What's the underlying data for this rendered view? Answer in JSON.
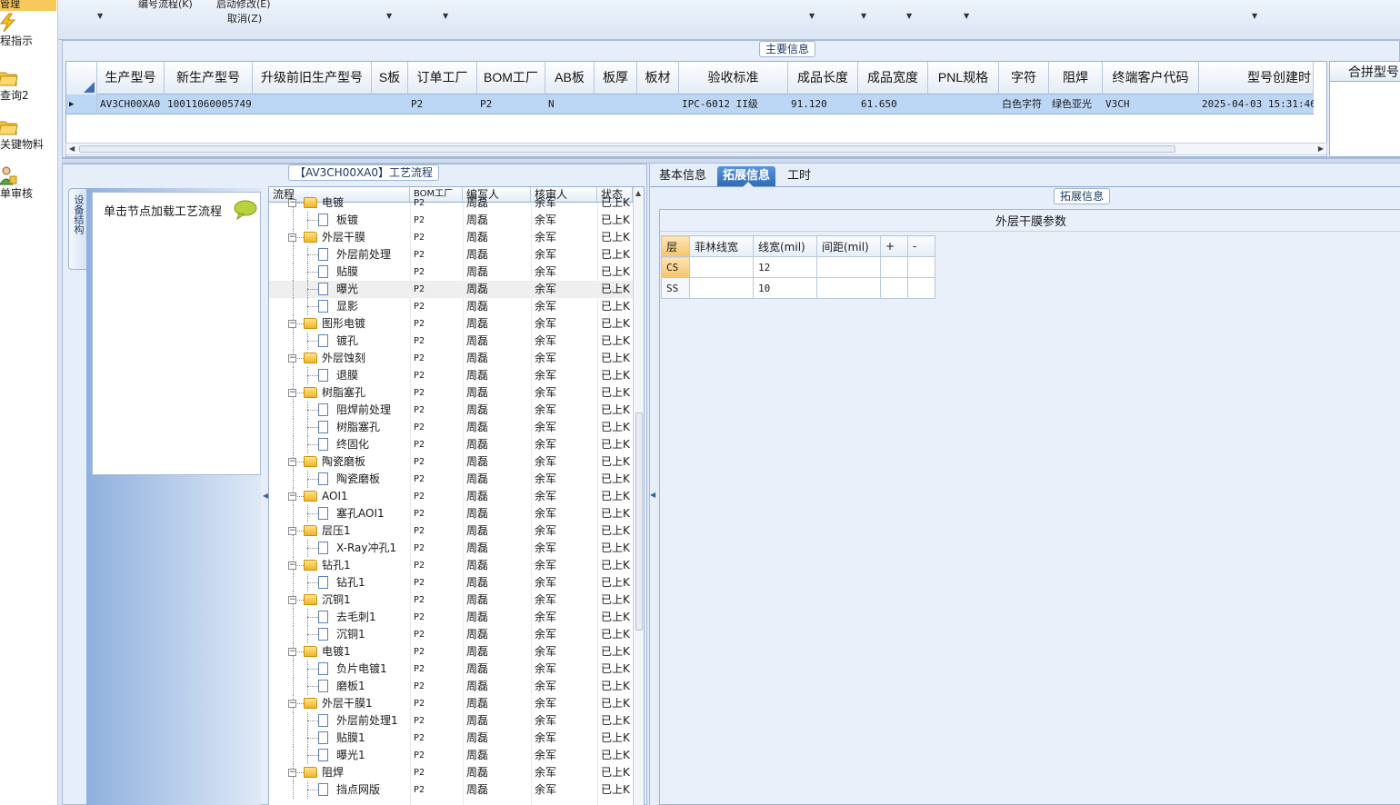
{
  "nav": {
    "top_item": "管理",
    "items": [
      {
        "label": "程指示",
        "icon": "lightning-icon"
      },
      {
        "label": "查询2",
        "icon": "folder-open-icon"
      },
      {
        "label": "关键物料",
        "icon": "folder-open-icon"
      },
      {
        "label": "单审核",
        "icon": "user-icon"
      }
    ]
  },
  "topbar": {
    "label1": "编号流程(K)",
    "label2": "启动修改(E)",
    "label3": "取消(Z)"
  },
  "main_info": {
    "legend": "主要信息",
    "columns": [
      "生产型号",
      "新生产型号",
      "升级前旧生产型号",
      "S板",
      "订单工厂",
      "BOM工厂",
      "AB板",
      "板厚",
      "板材",
      "验收标准",
      "成品长度",
      "成品宽度",
      "PNL规格",
      "字符",
      "阻焊",
      "终端客户代码",
      "型号创建时"
    ],
    "row": [
      "AV3CH00XA0",
      "10011060005749",
      "",
      "",
      "P2",
      "P2",
      "N",
      "",
      "",
      "IPC-6012 II级",
      "91.120",
      "61.650",
      "",
      "白色字符",
      "绿色亚光",
      "V3CH",
      "2025-04-03 15:31:46"
    ],
    "merge_header": "合拼型号"
  },
  "process": {
    "legend": "【AV3CH00XA0】工艺流程",
    "vertical_tab": "设备结构",
    "tip": "单击节点加载工艺流程",
    "columns": [
      "流程",
      "BOM工厂",
      "编写人",
      "核审人",
      "状态"
    ],
    "rows": [
      {
        "name": "电镀",
        "level": 0,
        "bom": "P2",
        "writer": "周磊",
        "checker": "余军",
        "status": "已上K"
      },
      {
        "name": "板镀",
        "level": 1,
        "bom": "P2",
        "writer": "周磊",
        "checker": "余军",
        "status": "已上K"
      },
      {
        "name": "外层干膜",
        "level": 0,
        "bom": "P2",
        "writer": "周磊",
        "checker": "余军",
        "status": "已上K"
      },
      {
        "name": "外层前处理",
        "level": 1,
        "bom": "P2",
        "writer": "周磊",
        "checker": "余军",
        "status": "已上K"
      },
      {
        "name": "贴膜",
        "level": 1,
        "bom": "P2",
        "writer": "周磊",
        "checker": "余军",
        "status": "已上K"
      },
      {
        "name": "曝光",
        "level": 1,
        "bom": "P2",
        "writer": "周磊",
        "checker": "余军",
        "status": "已上K",
        "selected": true
      },
      {
        "name": "显影",
        "level": 1,
        "bom": "P2",
        "writer": "周磊",
        "checker": "余军",
        "status": "已上K"
      },
      {
        "name": "图形电镀",
        "level": 0,
        "bom": "P2",
        "writer": "周磊",
        "checker": "余军",
        "status": "已上K"
      },
      {
        "name": "镀孔",
        "level": 1,
        "bom": "P2",
        "writer": "周磊",
        "checker": "余军",
        "status": "已上K"
      },
      {
        "name": "外层蚀刻",
        "level": 0,
        "bom": "P2",
        "writer": "周磊",
        "checker": "余军",
        "status": "已上K"
      },
      {
        "name": "退膜",
        "level": 1,
        "bom": "P2",
        "writer": "周磊",
        "checker": "余军",
        "status": "已上K"
      },
      {
        "name": "树脂塞孔",
        "level": 0,
        "bom": "P2",
        "writer": "周磊",
        "checker": "余军",
        "status": "已上K"
      },
      {
        "name": "阻焊前处理",
        "level": 1,
        "bom": "P2",
        "writer": "周磊",
        "checker": "余军",
        "status": "已上K"
      },
      {
        "name": "树脂塞孔",
        "level": 1,
        "bom": "P2",
        "writer": "周磊",
        "checker": "余军",
        "status": "已上K"
      },
      {
        "name": "终固化",
        "level": 1,
        "bom": "P2",
        "writer": "周磊",
        "checker": "余军",
        "status": "已上K"
      },
      {
        "name": "陶瓷磨板",
        "level": 0,
        "bom": "P2",
        "writer": "周磊",
        "checker": "余军",
        "status": "已上K"
      },
      {
        "name": "陶瓷磨板",
        "level": 1,
        "bom": "P2",
        "writer": "周磊",
        "checker": "余军",
        "status": "已上K"
      },
      {
        "name": "AOI1",
        "level": 0,
        "bom": "P2",
        "writer": "周磊",
        "checker": "余军",
        "status": "已上K"
      },
      {
        "name": "塞孔AOI1",
        "level": 1,
        "bom": "P2",
        "writer": "周磊",
        "checker": "余军",
        "status": "已上K"
      },
      {
        "name": "层压1",
        "level": 0,
        "bom": "P2",
        "writer": "周磊",
        "checker": "余军",
        "status": "已上K"
      },
      {
        "name": "X-Ray冲孔1",
        "level": 1,
        "bom": "P2",
        "writer": "周磊",
        "checker": "余军",
        "status": "已上K"
      },
      {
        "name": "钻孔1",
        "level": 0,
        "bom": "P2",
        "writer": "周磊",
        "checker": "余军",
        "status": "已上K"
      },
      {
        "name": "钻孔1",
        "level": 1,
        "bom": "P2",
        "writer": "周磊",
        "checker": "余军",
        "status": "已上K"
      },
      {
        "name": "沉铜1",
        "level": 0,
        "bom": "P2",
        "writer": "周磊",
        "checker": "余军",
        "status": "已上K"
      },
      {
        "name": "去毛刺1",
        "level": 1,
        "bom": "P2",
        "writer": "周磊",
        "checker": "余军",
        "status": "已上K"
      },
      {
        "name": "沉铜1",
        "level": 1,
        "bom": "P2",
        "writer": "周磊",
        "checker": "余军",
        "status": "已上K"
      },
      {
        "name": "电镀1",
        "level": 0,
        "bom": "P2",
        "writer": "周磊",
        "checker": "余军",
        "status": "已上K"
      },
      {
        "name": "负片电镀1",
        "level": 1,
        "bom": "P2",
        "writer": "周磊",
        "checker": "余军",
        "status": "已上K"
      },
      {
        "name": "磨板1",
        "level": 1,
        "bom": "P2",
        "writer": "周磊",
        "checker": "余军",
        "status": "已上K"
      },
      {
        "name": "外层干膜1",
        "level": 0,
        "bom": "P2",
        "writer": "周磊",
        "checker": "余军",
        "status": "已上K"
      },
      {
        "name": "外层前处理1",
        "level": 1,
        "bom": "P2",
        "writer": "周磊",
        "checker": "余军",
        "status": "已上K"
      },
      {
        "name": "贴膜1",
        "level": 1,
        "bom": "P2",
        "writer": "周磊",
        "checker": "余军",
        "status": "已上K"
      },
      {
        "name": "曝光1",
        "level": 1,
        "bom": "P2",
        "writer": "周磊",
        "checker": "余军",
        "status": "已上K"
      },
      {
        "name": "阻焊",
        "level": 0,
        "bom": "P2",
        "writer": "周磊",
        "checker": "余军",
        "status": "已上K"
      },
      {
        "name": "挡点网版",
        "level": 1,
        "bom": "P2",
        "writer": "周磊",
        "checker": "余军",
        "status": "已上K"
      }
    ]
  },
  "detail": {
    "tabs": [
      {
        "label": "基本信息",
        "active": false
      },
      {
        "label": "拓展信息",
        "active": true
      },
      {
        "label": "工时",
        "active": false
      }
    ],
    "legend": "拓展信息",
    "caption": "外层干膜参数",
    "param_headers": [
      "层",
      "菲林线宽",
      "线宽(mil)",
      "间距(mil)",
      "+",
      "-"
    ],
    "param_rows": [
      [
        "CS",
        "",
        "12",
        "",
        "",
        ""
      ],
      [
        "SS",
        "",
        "10",
        "",
        "",
        ""
      ]
    ]
  }
}
